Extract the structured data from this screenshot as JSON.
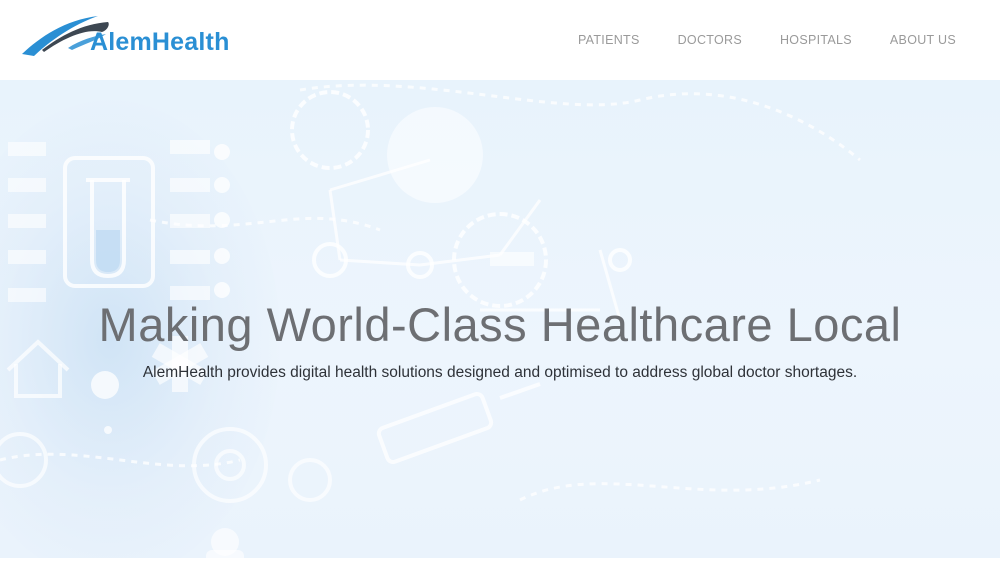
{
  "brand": {
    "name": "AlemHealth",
    "logo_icon": "swoosh-logo-icon",
    "colors": {
      "primary": "#2a8fd4",
      "swoosh_dark": "#3d4752",
      "swoosh_light": "#2a8fd4"
    }
  },
  "nav": {
    "items": [
      {
        "label": "PATIENTS"
      },
      {
        "label": "DOCTORS"
      },
      {
        "label": "HOSPITALS"
      },
      {
        "label": "ABOUT US"
      }
    ]
  },
  "hero": {
    "title": "Making World-Class Healthcare Local",
    "subtitle": "AlemHealth provides digital health solutions designed and optimised to address global doctor shortages.",
    "background_icons": [
      "test-tube-icon",
      "gear-icon",
      "home-icon",
      "medical-star-icon",
      "syringe-icon",
      "stethoscope-icon",
      "person-icon"
    ],
    "colors": {
      "background": "#e8f3fc",
      "title": "#6d6f73",
      "subtitle": "#2e3238"
    }
  }
}
